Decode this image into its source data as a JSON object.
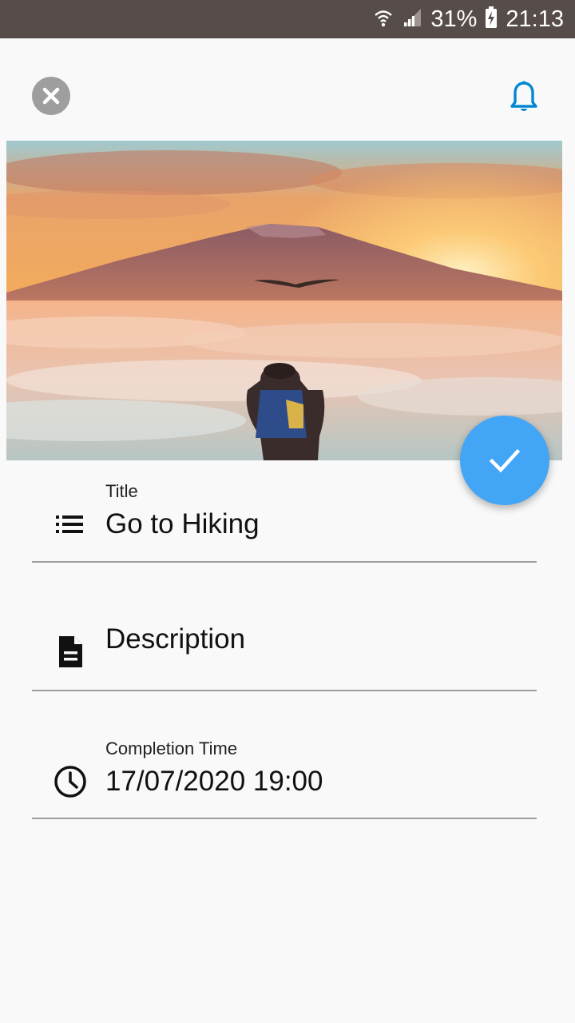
{
  "status_bar": {
    "battery_percent": "31%",
    "time": "21:13",
    "icons": [
      "wifi-icon",
      "signal-icon",
      "battery-charging-icon"
    ],
    "background": "#564c4a"
  },
  "toolbar": {
    "close_icon": "close-icon",
    "reminder_icon": "bell-icon",
    "accent": "#0288d1"
  },
  "hero": {
    "image": "mountain-sunset-hiker-photo"
  },
  "fab": {
    "icon": "check-icon",
    "color": "#42a5f5"
  },
  "form": {
    "title": {
      "label": "Title",
      "value": "Go to Hiking",
      "icon": "list-icon"
    },
    "description": {
      "placeholder": "Description",
      "icon": "document-icon"
    },
    "completion": {
      "label": "Completion Time",
      "value": "17/07/2020 19:00",
      "icon": "clock-icon"
    }
  }
}
